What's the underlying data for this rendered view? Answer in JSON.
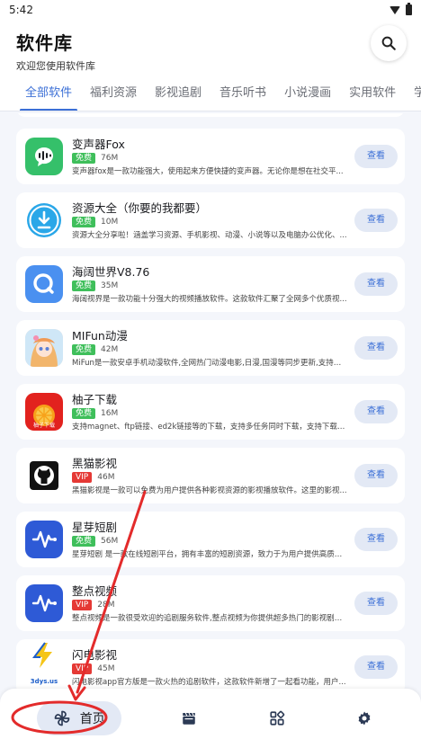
{
  "status_bar": {
    "time": "5:42"
  },
  "header": {
    "title": "软件库",
    "subtitle": "欢迎您使用软件库"
  },
  "tabs": [
    {
      "label": "全部软件",
      "active": true
    },
    {
      "label": "福利资源"
    },
    {
      "label": "影视追剧"
    },
    {
      "label": "音乐听书"
    },
    {
      "label": "小说漫画"
    },
    {
      "label": "实用软件"
    },
    {
      "label": "学习"
    }
  ],
  "colors": {
    "accent": "#3b6fd6",
    "free_badge": "#3fbf5b",
    "vip_badge": "#e53935",
    "annotation_red": "#e32b2b"
  },
  "apps": [
    {
      "name": "变声器Fox",
      "badge": "免费",
      "size": "76M",
      "desc": "变声器fox是一款功能强大，使用起来方便快捷的变声器。无论你是想在社交平...",
      "button": "查看",
      "icon": "voice-changer-icon"
    },
    {
      "name": "资源大全（你要的我都要）",
      "badge": "免费",
      "size": "10M",
      "desc": "资源大全分享啦！涵盖学习资源、手机影视、动漫、小说等以及电脑办公优化、...",
      "button": "查看",
      "icon": "download-icon"
    },
    {
      "name": "海阔世界V8.76",
      "badge": "免费",
      "size": "35M",
      "desc": "海阔视界是一款功能十分强大的视频播放软件。这款软件汇聚了全网多个优质视...",
      "button": "查看",
      "icon": "search-bubble-icon"
    },
    {
      "name": "MIFun动漫",
      "badge": "免费",
      "size": "42M",
      "desc": "MiFun是一款安卓手机动漫软件,全网热门动漫电影,日漫,国漫等同步更新,支持下...",
      "button": "查看",
      "icon": "anime-girl-icon"
    },
    {
      "name": "柚子下载",
      "badge": "免费",
      "size": "16M",
      "desc": "支持magnet、ftp链接、ed2k链接等的下载，支持多任务同时下载，支持下载预...",
      "button": "查看",
      "icon": "grapefruit-icon",
      "icon_caption": "柚子下载"
    },
    {
      "name": "黑猫影视",
      "badge": "VIP",
      "size": "46M",
      "desc": "黑猫影视是一款可以免费为用户提供各种影视资源的影视播放软件。这里的影视...",
      "button": "查看",
      "icon": "github-cat-icon"
    },
    {
      "name": "星芽短剧",
      "badge": "免费",
      "size": "56M",
      "desc": "星芽短剧 是一款在线短剧平台，拥有丰富的短剧资源，致力于为用户提供高质量...",
      "button": "查看",
      "icon": "audio-wave-icon"
    },
    {
      "name": "整点视频",
      "badge": "VIP",
      "size": "28M",
      "desc": "整点视频是一款很受欢迎的追剧服务软件,整点视频为你提供超多热门的影视剧资...",
      "button": "查看",
      "icon": "audio-wave-icon"
    },
    {
      "name": "闪电影视",
      "badge": "VIP",
      "size": "45M",
      "desc": "闪电影视app官方版是一款火热的追剧软件，这款软件新增了一起看功能，用户...",
      "button": "查看",
      "icon": "lightning-logo-icon",
      "icon_caption": "3dys.us"
    }
  ],
  "bottom_nav": [
    {
      "label": "首页",
      "icon": "pinwheel-icon",
      "active": true
    },
    {
      "label": "",
      "icon": "film-clapper-icon"
    },
    {
      "label": "",
      "icon": "apps-grid-icon"
    },
    {
      "label": "",
      "icon": "settings-gear-icon"
    }
  ]
}
